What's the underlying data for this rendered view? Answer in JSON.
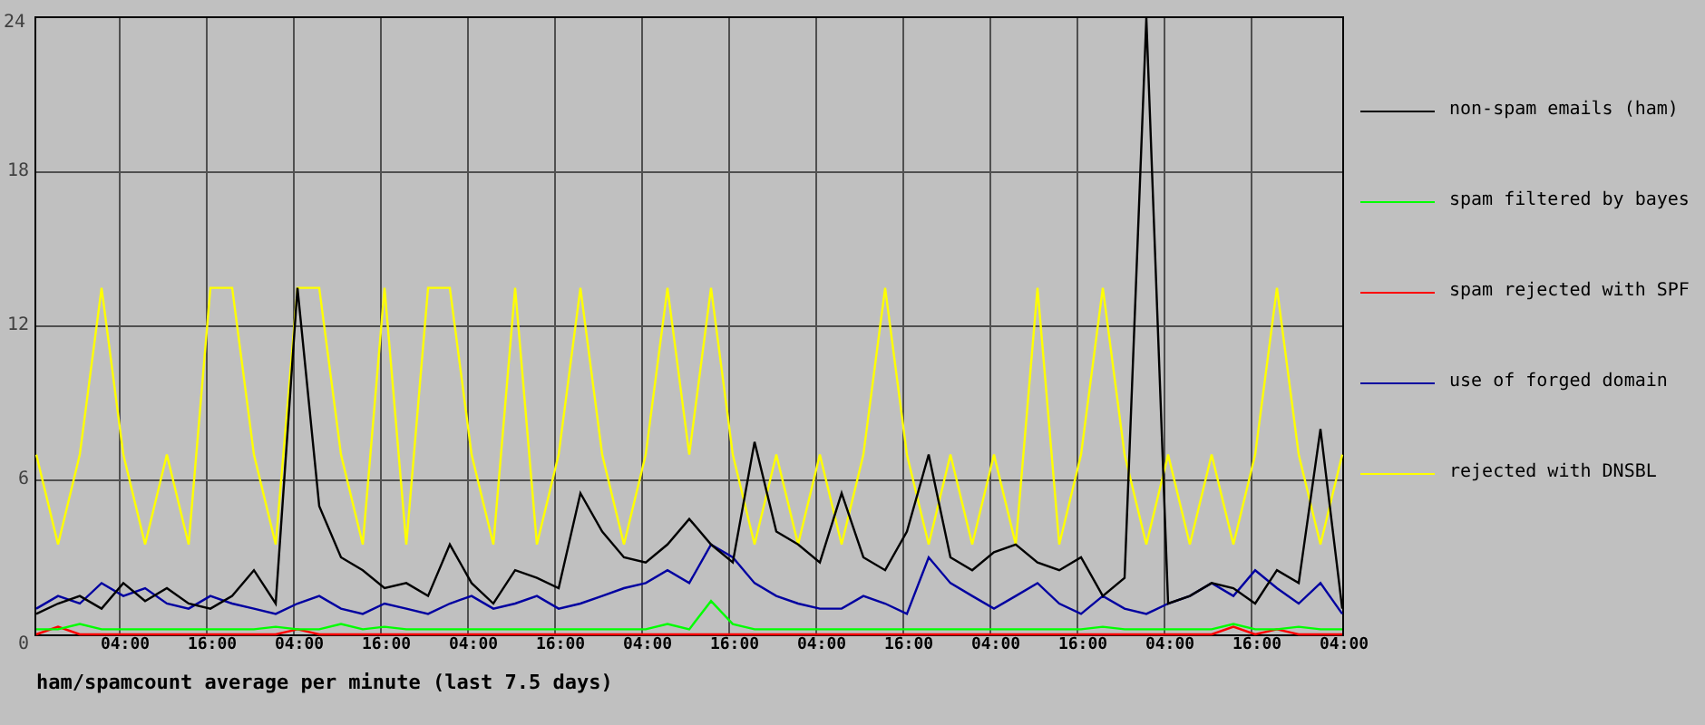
{
  "chart": {
    "chart_data": {
      "type": "line",
      "title": "ham/spamcount average per minute (last 7.5 days)",
      "categories": [
        null,
        null,
        null,
        null,
        "04:00",
        null,
        null,
        null,
        "16:00",
        null,
        null,
        null,
        "04:00",
        null,
        null,
        null,
        "16:00",
        null,
        null,
        null,
        "04:00",
        null,
        null,
        null,
        "16:00",
        null,
        null,
        null,
        "04:00",
        null,
        null,
        null,
        "16:00",
        null,
        null,
        null,
        "04:00",
        null,
        null,
        null,
        "16:00",
        null,
        null,
        null,
        "04:00",
        null,
        null,
        null,
        "16:00",
        null,
        null,
        null,
        "04:00",
        null,
        null,
        null,
        "16:00",
        null,
        null,
        null,
        "04:00"
      ],
      "grid": true,
      "ylim": [
        0,
        24
      ],
      "yticks": [
        0,
        6,
        12,
        18,
        24
      ],
      "series": [
        {
          "name": "non-spam emails (ham)",
          "color": "#000000",
          "values": [
            0.8,
            1.2,
            1.5,
            1,
            2,
            1.3,
            1.8,
            1.2,
            1,
            1.5,
            2.5,
            1.2,
            13.5,
            5,
            3,
            2.5,
            1.8,
            2,
            1.5,
            3.5,
            2,
            1.2,
            2.5,
            2.2,
            1.8,
            5.5,
            4,
            3,
            2.8,
            3.5,
            4.5,
            3.5,
            2.8,
            7.5,
            4,
            3.5,
            2.8,
            5.5,
            3,
            2.5,
            4,
            7,
            3,
            2.5,
            3.2,
            3.5,
            2.8,
            2.5,
            3,
            1.5,
            2.2,
            24,
            1.2,
            1.5,
            2,
            1.8,
            1.2,
            2.5,
            2,
            8,
            1
          ]
        },
        {
          "name": "spam filtered by bayes",
          "color": "#00ff00",
          "values": [
            0.2,
            0.2,
            0.4,
            0.2,
            0.2,
            0.2,
            0.2,
            0.2,
            0.2,
            0.2,
            0.2,
            0.3,
            0.2,
            0.2,
            0.4,
            0.2,
            0.3,
            0.2,
            0.2,
            0.2,
            0.2,
            0.2,
            0.2,
            0.2,
            0.2,
            0.2,
            0.2,
            0.2,
            0.2,
            0.4,
            0.2,
            1.3,
            0.4,
            0.2,
            0.2,
            0.2,
            0.2,
            0.2,
            0.2,
            0.2,
            0.2,
            0.2,
            0.2,
            0.2,
            0.2,
            0.2,
            0.2,
            0.2,
            0.2,
            0.3,
            0.2,
            0.2,
            0.2,
            0.2,
            0.2,
            0.4,
            0.2,
            0.2,
            0.3,
            0.2,
            0.2
          ]
        },
        {
          "name": "spam rejected with SPF",
          "color": "#ff0000",
          "values": [
            0,
            0.3,
            0,
            0,
            0,
            0,
            0,
            0,
            0,
            0,
            0,
            0,
            0.2,
            0,
            0,
            0,
            0,
            0,
            0,
            0,
            0,
            0,
            0,
            0,
            0,
            0,
            0,
            0,
            0,
            0,
            0,
            0,
            0,
            0,
            0,
            0,
            0,
            0,
            0,
            0,
            0,
            0,
            0,
            0,
            0,
            0,
            0,
            0,
            0,
            0,
            0,
            0,
            0,
            0,
            0,
            0.3,
            0,
            0.2,
            0,
            0,
            0
          ]
        },
        {
          "name": "use of forged domain",
          "color": "#0000a0",
          "values": [
            1,
            1.5,
            1.2,
            2,
            1.5,
            1.8,
            1.2,
            1,
            1.5,
            1.2,
            1,
            0.8,
            1.2,
            1.5,
            1,
            0.8,
            1.2,
            1,
            0.8,
            1.2,
            1.5,
            1,
            1.2,
            1.5,
            1,
            1.2,
            1.5,
            1.8,
            2,
            2.5,
            2,
            3.5,
            3,
            2,
            1.5,
            1.2,
            1,
            1,
            1.5,
            1.2,
            0.8,
            3,
            2,
            1.5,
            1,
            1.5,
            2,
            1.2,
            0.8,
            1.5,
            1,
            0.8,
            1.2,
            1.5,
            2,
            1.5,
            2.5,
            1.8,
            1.2,
            2,
            0.8
          ]
        },
        {
          "name": "rejected with DNSBL",
          "color": "#ffff00",
          "values": [
            7,
            3.5,
            7,
            13.5,
            7,
            3.5,
            7,
            3.5,
            13.5,
            13.5,
            7,
            3.5,
            13.5,
            13.5,
            7,
            3.5,
            13.5,
            3.5,
            13.5,
            13.5,
            7,
            3.5,
            13.5,
            3.5,
            7,
            13.5,
            7,
            3.5,
            7,
            13.5,
            7,
            13.5,
            7,
            3.5,
            7,
            3.5,
            7,
            3.5,
            7,
            13.5,
            7,
            3.5,
            7,
            3.5,
            7,
            3.5,
            13.5,
            3.5,
            7,
            13.5,
            7,
            3.5,
            7,
            3.5,
            7,
            3.5,
            7,
            13.5,
            7,
            3.5,
            7
          ]
        }
      ]
    }
  }
}
